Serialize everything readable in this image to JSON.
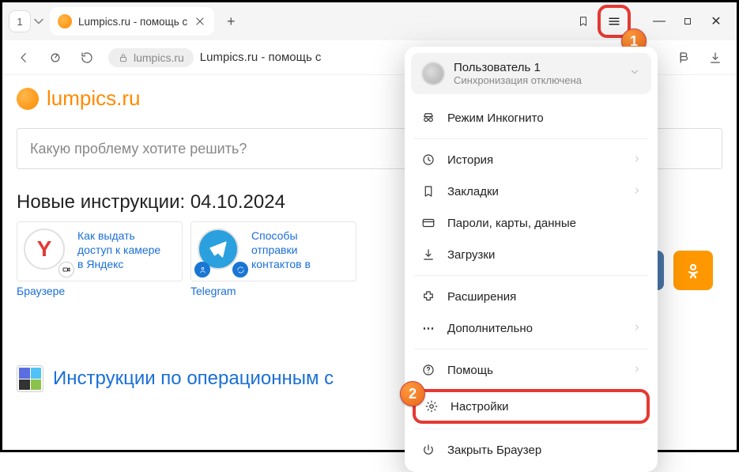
{
  "tabstrip": {
    "count": "1",
    "title": "Lumpics.ru - помощь с",
    "newtab_glyph": "+"
  },
  "window": {
    "minimize": "—",
    "close": "✕"
  },
  "address": {
    "domain": "lumpics.ru",
    "title": "Lumpics.ru - помощь с"
  },
  "page": {
    "logo": "lumpics.ru",
    "search_placeholder": "Какую проблему хотите решить?",
    "new_section": "Новые инструкции: 04.10.2024",
    "card1": {
      "l1": "Как выдать",
      "l2": "доступ к камере",
      "l3": "в Яндекс",
      "foot": "Браузере"
    },
    "card2": {
      "l1": "Способы",
      "l2": "отправки",
      "l3": "контактов в",
      "foot": "Telegram"
    },
    "os_link": "Инструкции по операционным с",
    "social": {
      "vk": "Ꮃ",
      "ok": "✳"
    }
  },
  "menu": {
    "user": {
      "name": "Пользователь 1",
      "sub": "Синхронизация отключена"
    },
    "incognito": "Режим Инкогнито",
    "history": "История",
    "bookmarks": "Закладки",
    "passwords": "Пароли, карты, данные",
    "downloads": "Загрузки",
    "extensions": "Расширения",
    "more": "Дополнительно",
    "help": "Помощь",
    "settings": "Настройки",
    "quit": "Закрыть Браузер"
  },
  "annotations": {
    "b1": "1",
    "b2": "2"
  }
}
